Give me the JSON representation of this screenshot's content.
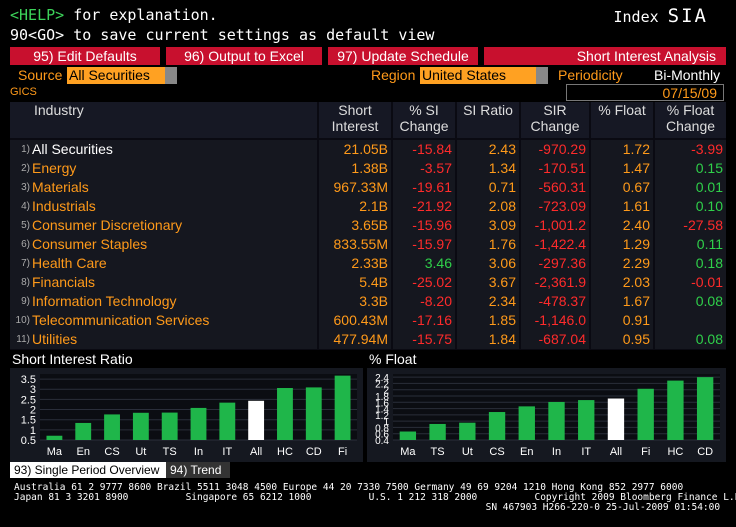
{
  "header": {
    "help_key": "<HELP>",
    "help_text": " for explanation.",
    "line2": "90<GO> to save current settings as default view",
    "index_label": "Index",
    "index_code": "SIA"
  },
  "buttons": [
    {
      "label": "95)  Edit Defaults"
    },
    {
      "label": "96)  Output to Excel"
    },
    {
      "label": "97)  Update Schedule"
    }
  ],
  "screen_title": "Short Interest Analysis",
  "filters": {
    "source_label": "Source",
    "source_value": "All Securities",
    "region_label": "Region",
    "region_value": "United States",
    "periodicity_label": "Periodicity",
    "periodicity_value": "Bi-Monthly",
    "date": "07/15/09"
  },
  "gics_label": "GICS",
  "table": {
    "headers": [
      {
        "l1": "Industry",
        "l2": ""
      },
      {
        "l1": "Short",
        "l2": "Interest"
      },
      {
        "l1": "% SI",
        "l2": "Change"
      },
      {
        "l1": "SI Ratio",
        "l2": ""
      },
      {
        "l1": "SIR",
        "l2": "Change"
      },
      {
        "l1": "% Float",
        "l2": ""
      },
      {
        "l1": "% Float",
        "l2": "Change"
      }
    ],
    "rows": [
      {
        "num": "1)",
        "name": "All Securities",
        "si": "21.05B",
        "si_chg": "-15.84",
        "sir": "2.43",
        "sir_chg": "-970.29",
        "flt": "1.72",
        "flt_chg": "-3.99"
      },
      {
        "num": "2)",
        "name": "Energy",
        "si": "1.38B",
        "si_chg": "-3.57",
        "sir": "1.34",
        "sir_chg": "-170.51",
        "flt": "1.47",
        "flt_chg": "0.15"
      },
      {
        "num": "3)",
        "name": "Materials",
        "si": "967.33M",
        "si_chg": "-19.61",
        "sir": "0.71",
        "sir_chg": "-560.31",
        "flt": "0.67",
        "flt_chg": "0.01"
      },
      {
        "num": "4)",
        "name": "Industrials",
        "si": "2.1B",
        "si_chg": "-21.92",
        "sir": "2.08",
        "sir_chg": "-723.09",
        "flt": "1.61",
        "flt_chg": "0.10"
      },
      {
        "num": "5)",
        "name": "Consumer Discretionary",
        "si": "3.65B",
        "si_chg": "-15.96",
        "sir": "3.09",
        "sir_chg": "-1,001.2",
        "flt": "2.40",
        "flt_chg": "-27.58"
      },
      {
        "num": "6)",
        "name": "Consumer Staples",
        "si": "833.55M",
        "si_chg": "-15.97",
        "sir": "1.76",
        "sir_chg": "-1,422.4",
        "flt": "1.29",
        "flt_chg": "0.11"
      },
      {
        "num": "7)",
        "name": "Health Care",
        "si": "2.33B",
        "si_chg": "3.46",
        "sir": "3.06",
        "sir_chg": "-297.36",
        "flt": "2.29",
        "flt_chg": "0.18"
      },
      {
        "num": "8)",
        "name": "Financials",
        "si": "5.4B",
        "si_chg": "-25.02",
        "sir": "3.67",
        "sir_chg": "-2,361.9",
        "flt": "2.03",
        "flt_chg": "-0.01"
      },
      {
        "num": "9)",
        "name": "Information Technology",
        "si": "3.3B",
        "si_chg": "-8.20",
        "sir": "2.34",
        "sir_chg": "-478.37",
        "flt": "1.67",
        "flt_chg": "0.08"
      },
      {
        "num": "10)",
        "name": "Telecommunication Services",
        "si": "600.43M",
        "si_chg": "-17.16",
        "sir": "1.85",
        "sir_chg": "-1,146.0",
        "flt": "0.91",
        "flt_chg": ""
      },
      {
        "num": "11)",
        "name": "Utilities",
        "si": "477.94M",
        "si_chg": "-15.75",
        "sir": "1.84",
        "sir_chg": "-687.04",
        "flt": "0.95",
        "flt_chg": "0.08"
      }
    ]
  },
  "colors": {
    "accent_orange": "#ff9a1a",
    "negative": "#ff2b2b",
    "positive": "#2fd04a",
    "bar": "#1fb64a",
    "highlight_bar": "#ffffff",
    "button_red": "#c8102e"
  },
  "chart_data": [
    {
      "type": "bar",
      "title": "Short Interest Ratio",
      "categories": [
        "Ma",
        "En",
        "CS",
        "Ut",
        "TS",
        "In",
        "IT",
        "All",
        "HC",
        "CD",
        "Fi"
      ],
      "values": [
        0.71,
        1.34,
        1.76,
        1.84,
        1.85,
        2.08,
        2.34,
        2.43,
        3.06,
        3.09,
        3.67
      ],
      "highlight": "All",
      "yticks": [
        "3.5",
        "3",
        "2.5",
        "2",
        "1.5",
        "1",
        "0.5"
      ],
      "ylim": [
        0.5,
        3.75
      ]
    },
    {
      "type": "bar",
      "title": "% Float",
      "categories": [
        "Ma",
        "TS",
        "Ut",
        "CS",
        "En",
        "In",
        "IT",
        "All",
        "Fi",
        "HC",
        "CD"
      ],
      "values": [
        0.67,
        0.91,
        0.95,
        1.29,
        1.47,
        1.61,
        1.67,
        1.72,
        2.03,
        2.29,
        2.4
      ],
      "highlight": "All",
      "yticks": [
        "2.4",
        "2.2",
        "2",
        "1.8",
        "1.6",
        "1.4",
        "1.2",
        "1",
        "0.8",
        "0.6",
        "0.4"
      ],
      "ylim": [
        0.4,
        2.5
      ]
    }
  ],
  "tabs": [
    {
      "label": "93) Single Period Overview"
    },
    {
      "label": "94) Trend"
    }
  ],
  "footer": {
    "line1": "Australia 61 2 9777 8600 Brazil 5511 3048 4500 Europe 44 20 7330 7500 Germany 49 69 9204 1210 Hong Kong 852 2977 6000",
    "line2a": "Japan 81 3 3201 8900          Singapore 65 6212 1000          U.S. 1 212 318 2000          Copyright 2009 Bloomberg Finance L.P.",
    "line3": "SN 467903 H266-220-0 25-Jul-2009 01:54:00"
  }
}
